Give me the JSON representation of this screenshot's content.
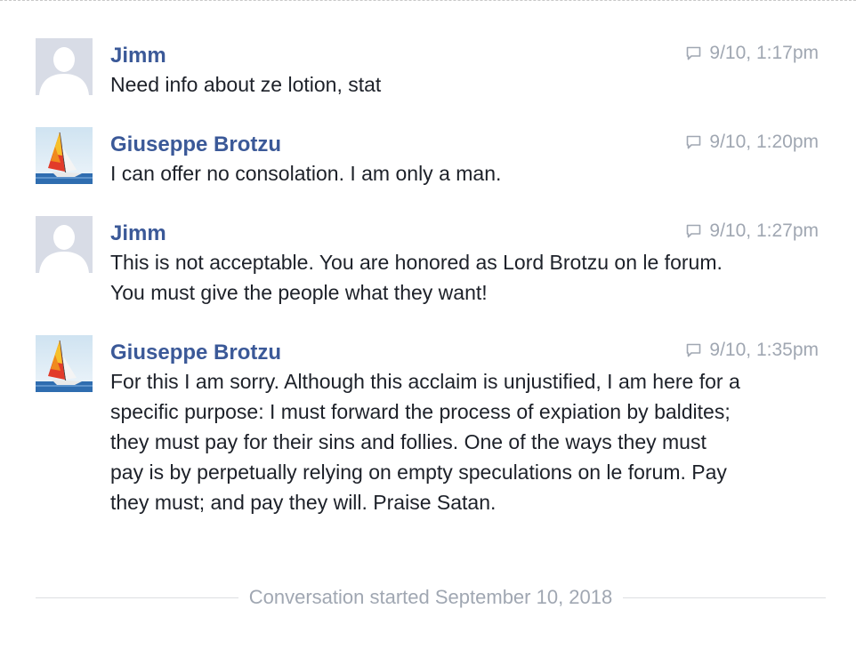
{
  "messages": [
    {
      "author": "Jimm",
      "avatar_icon": "default-profile-silhouette-icon",
      "time": "9/10, 1:17pm",
      "text": "Need info about ze lotion, stat"
    },
    {
      "author": "Giuseppe Brotzu",
      "avatar_icon": "sailboat-photo",
      "time": "9/10, 1:20pm",
      "text": "I can offer no consolation. I am only a man."
    },
    {
      "author": "Jimm",
      "avatar_icon": "default-profile-silhouette-icon",
      "time": "9/10, 1:27pm",
      "text": "This is not acceptable. You are honored as Lord Brotzu on le forum. You must give the people what they want!"
    },
    {
      "author": "Giuseppe Brotzu",
      "avatar_icon": "sailboat-photo",
      "time": "9/10, 1:35pm",
      "text": "For this I am sorry. Although this acclaim is unjustified, I am here for a specific purpose: I must forward the process of expiation by baldites; they must pay for their sins and follies. One of the ways they must pay is by perpetually relying on empty speculations on le forum. Pay they must; and pay they will. Praise Satan."
    }
  ],
  "footer": {
    "conversation_started": "Conversation started September 10, 2018"
  },
  "colors": {
    "author_link": "#3b5998",
    "body_text": "#1d2129",
    "muted_text": "#a0a7b2",
    "divider": "#dddfe2",
    "placeholder_avatar": "#d8dce6"
  }
}
